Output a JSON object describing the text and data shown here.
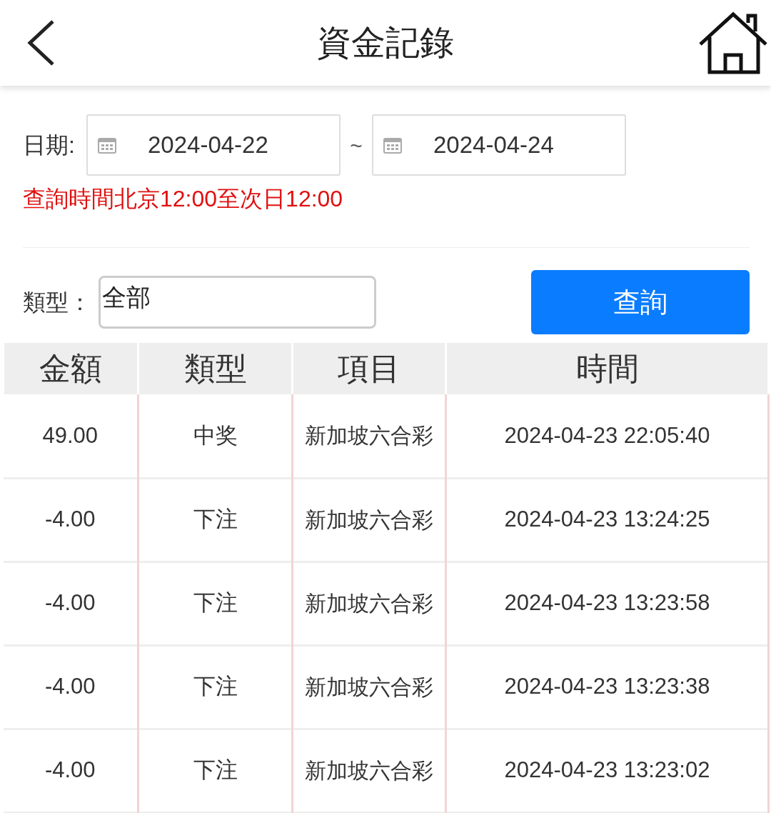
{
  "header": {
    "title": "資金記錄"
  },
  "date_filter": {
    "label": "日期:",
    "start": "2024-04-22",
    "separator": "~",
    "end": "2024-04-24",
    "note": "查詢時間北京12:00至次日12:00"
  },
  "type_filter": {
    "label": "類型：",
    "value": "全部",
    "button": "查詢"
  },
  "table": {
    "columns": [
      "金額",
      "類型",
      "項目",
      "時間"
    ],
    "rows": [
      [
        "49.00",
        "中奖",
        "新加坡六合彩",
        "2024-04-23 22:05:40"
      ],
      [
        "-4.00",
        "下注",
        "新加坡六合彩",
        "2024-04-23 13:24:25"
      ],
      [
        "-4.00",
        "下注",
        "新加坡六合彩",
        "2024-04-23 13:23:58"
      ],
      [
        "-4.00",
        "下注",
        "新加坡六合彩",
        "2024-04-23 13:23:38"
      ],
      [
        "-4.00",
        "下注",
        "新加坡六合彩",
        "2024-04-23 13:23:02"
      ]
    ]
  }
}
